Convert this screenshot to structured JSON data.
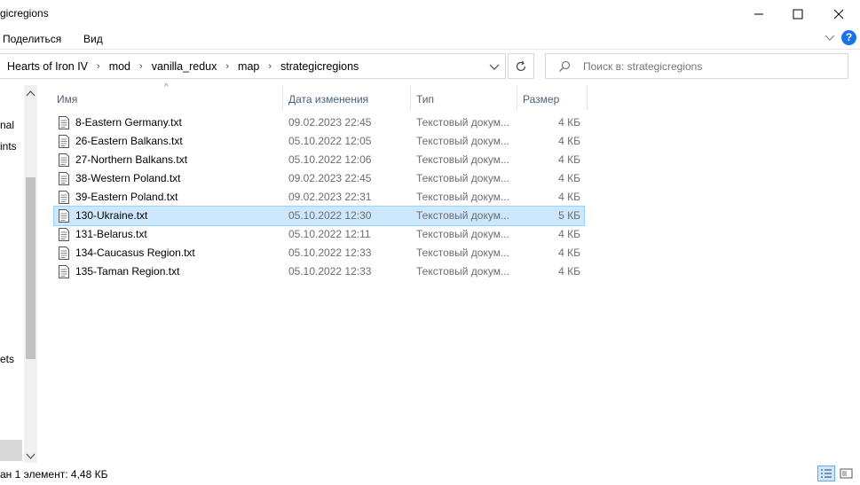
{
  "window": {
    "title": "gicregions",
    "minimize_glyph": "—",
    "maximize_glyph": "☐",
    "close_glyph": "✕"
  },
  "ribbon": {
    "tabs": [
      "Поделиться",
      "Вид"
    ],
    "help_glyph": "?",
    "expand_glyph": "⌄"
  },
  "address": {
    "breadcrumbs": [
      "Hearts of Iron IV",
      "mod",
      "vanilla_redux",
      "map",
      "strategicregions"
    ],
    "separator": "›",
    "dropdown_glyph": "⌄",
    "refresh_glyph": "↻"
  },
  "search": {
    "placeholder": "Поиск в: strategicregions",
    "icon": "search-icon"
  },
  "nav": {
    "items": [
      "nal",
      "ints",
      "ets"
    ],
    "scroll_up": "˄",
    "scroll_down": "˅"
  },
  "columns": {
    "name": "Имя",
    "date": "Дата изменения",
    "type": "Тип",
    "size": "Размер",
    "sort_glyph": "^"
  },
  "files": [
    {
      "name": "8-Eastern Germany.txt",
      "date": "09.02.2023 22:45",
      "type": "Текстовый докум...",
      "size": "4 КБ",
      "selected": false
    },
    {
      "name": "26-Eastern Balkans.txt",
      "date": "05.10.2022 12:05",
      "type": "Текстовый докум...",
      "size": "4 КБ",
      "selected": false
    },
    {
      "name": "27-Northern Balkans.txt",
      "date": "05.10.2022 12:06",
      "type": "Текстовый докум...",
      "size": "4 КБ",
      "selected": false
    },
    {
      "name": "38-Western Poland.txt",
      "date": "09.02.2023 22:45",
      "type": "Текстовый докум...",
      "size": "4 КБ",
      "selected": false
    },
    {
      "name": "39-Eastern Poland.txt",
      "date": "09.02.2023 22:31",
      "type": "Текстовый докум...",
      "size": "4 КБ",
      "selected": false
    },
    {
      "name": "130-Ukraine.txt",
      "date": "05.10.2022 12:30",
      "type": "Текстовый докум...",
      "size": "5 КБ",
      "selected": true
    },
    {
      "name": "131-Belarus.txt",
      "date": "05.10.2022 12:11",
      "type": "Текстовый докум...",
      "size": "4 КБ",
      "selected": false
    },
    {
      "name": "134-Caucasus Region.txt",
      "date": "05.10.2022 12:33",
      "type": "Текстовый докум...",
      "size": "4 КБ",
      "selected": false
    },
    {
      "name": "135-Taman Region.txt",
      "date": "05.10.2022 12:33",
      "type": "Текстовый докум...",
      "size": "4 КБ",
      "selected": false
    }
  ],
  "status": {
    "text": "ан 1 элемент: 4,48 КБ"
  },
  "colors": {
    "selection_bg": "#cce8ff",
    "selection_border": "#99d1ff",
    "header_text": "#4c607a",
    "help_blue": "#1a73e8"
  }
}
